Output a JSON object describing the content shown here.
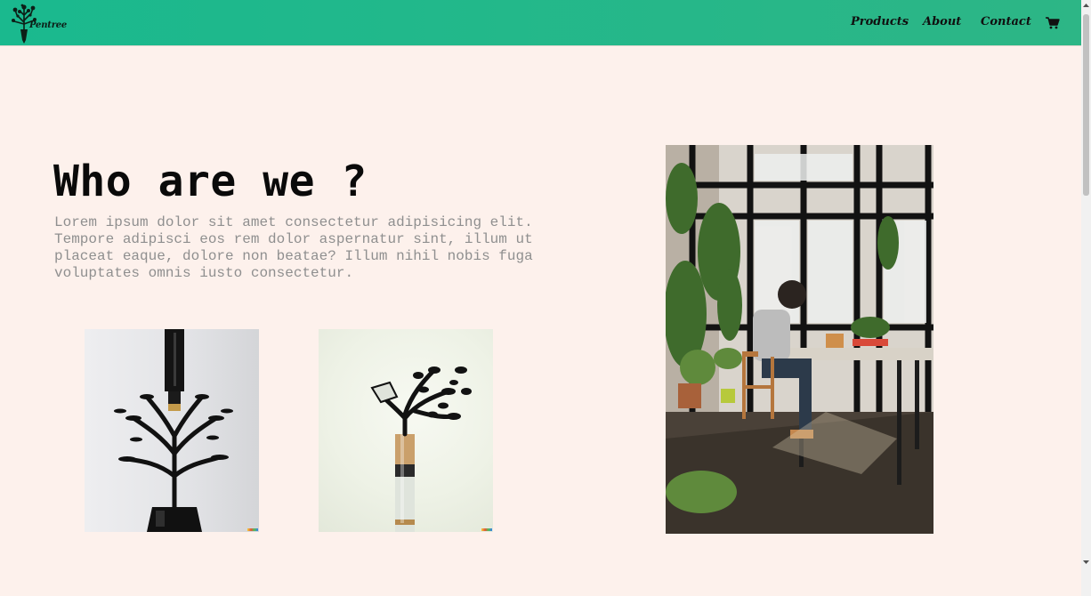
{
  "nav": {
    "brand": "Pentree",
    "links": [
      "Products",
      "About",
      "Contact"
    ],
    "cart_icon": "shopping-cart-icon"
  },
  "hero": {
    "title": "Who are we ?",
    "body": "Lorem ipsum dolor sit amet consectetur adipisicing elit. Tempore adipisci eos rem dolor aspernatur sint, illum ut placeat eaque, dolore non beatae? Illum nihil nobis fuga voluptates omnis iusto consectetur."
  },
  "colors": {
    "nav_bg": "#20b78a",
    "page_bg": "#fdf1ec",
    "title": "#0a0a0a",
    "body_text": "#8f8f8f"
  }
}
